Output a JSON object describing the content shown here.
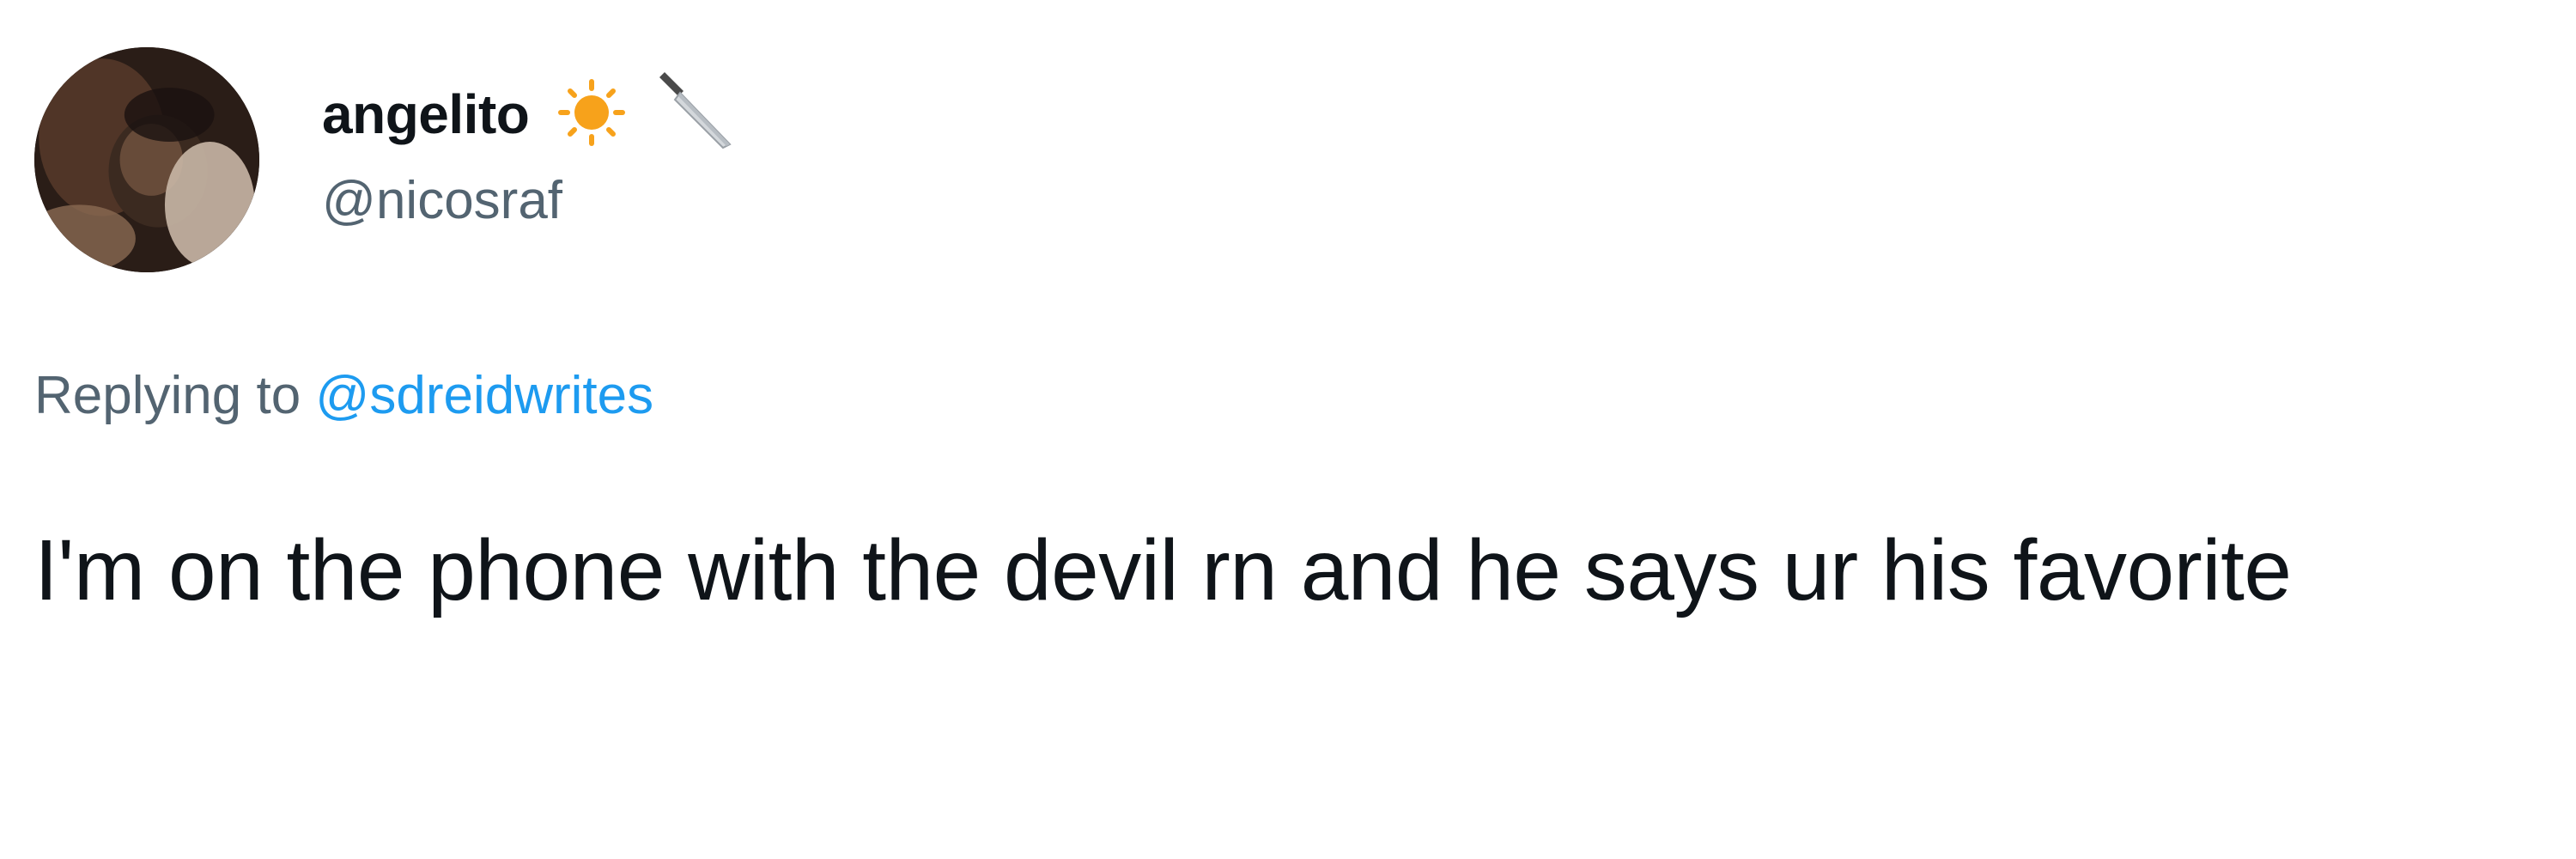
{
  "author": {
    "display_name": "angelito",
    "handle": "@nicosraf",
    "emojis": [
      "sun-emoji",
      "knife-emoji"
    ]
  },
  "reply": {
    "prefix": "Replying to ",
    "target": "@sdreidwrites"
  },
  "tweet": {
    "text": "I'm on the phone with the devil rn and he says ur his favorite"
  },
  "colors": {
    "text_primary": "#0f1419",
    "text_secondary": "#536471",
    "link": "#1d9bf0",
    "background": "#ffffff"
  }
}
